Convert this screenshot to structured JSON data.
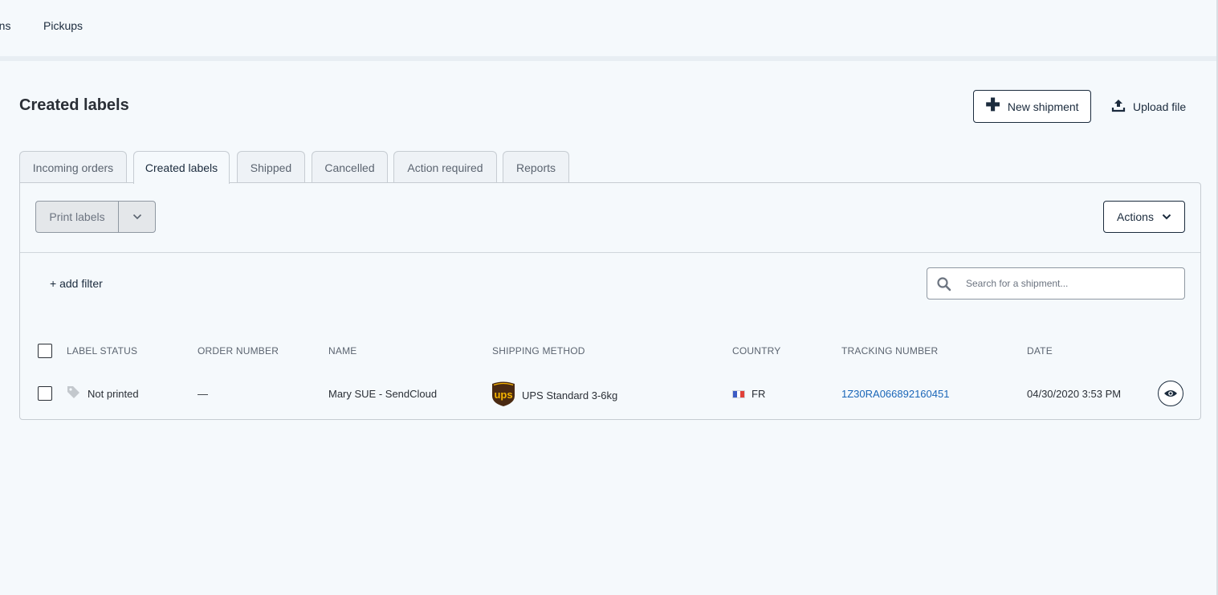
{
  "topnav": {
    "items": [
      {
        "label": "rns"
      },
      {
        "label": "Pickups"
      }
    ]
  },
  "page": {
    "title": "Created labels",
    "new_shipment_label": "New shipment",
    "upload_file_label": "Upload file"
  },
  "tabs": [
    {
      "label": "Incoming orders",
      "active": false
    },
    {
      "label": "Created labels",
      "active": true
    },
    {
      "label": "Shipped",
      "active": false
    },
    {
      "label": "Cancelled",
      "active": false
    },
    {
      "label": "Action required",
      "active": false
    },
    {
      "label": "Reports",
      "active": false
    }
  ],
  "toolbar": {
    "print_labels": "Print labels",
    "actions": "Actions"
  },
  "filters": {
    "add_filter": "+ add filter",
    "search_placeholder": "Search for a shipment..."
  },
  "table": {
    "columns": [
      "LABEL STATUS",
      "ORDER NUMBER",
      "NAME",
      "SHIPPING METHOD",
      "COUNTRY",
      "TRACKING NUMBER",
      "DATE"
    ],
    "rows": [
      {
        "label_status": "Not printed",
        "order_number": "—",
        "name": "Mary SUE - SendCloud",
        "carrier_logo_text": "ups",
        "shipping_method": "UPS Standard 3-6kg",
        "country": "FR",
        "tracking_number": "1Z30RA066892160451",
        "date": "04/30/2020 3:53 PM"
      }
    ]
  },
  "colors": {
    "background": "#f5f9fc",
    "primary": "#1b2b3d",
    "link": "#1a66b8",
    "ups_brown": "#4a2a12",
    "ups_gold": "#f5b400"
  }
}
